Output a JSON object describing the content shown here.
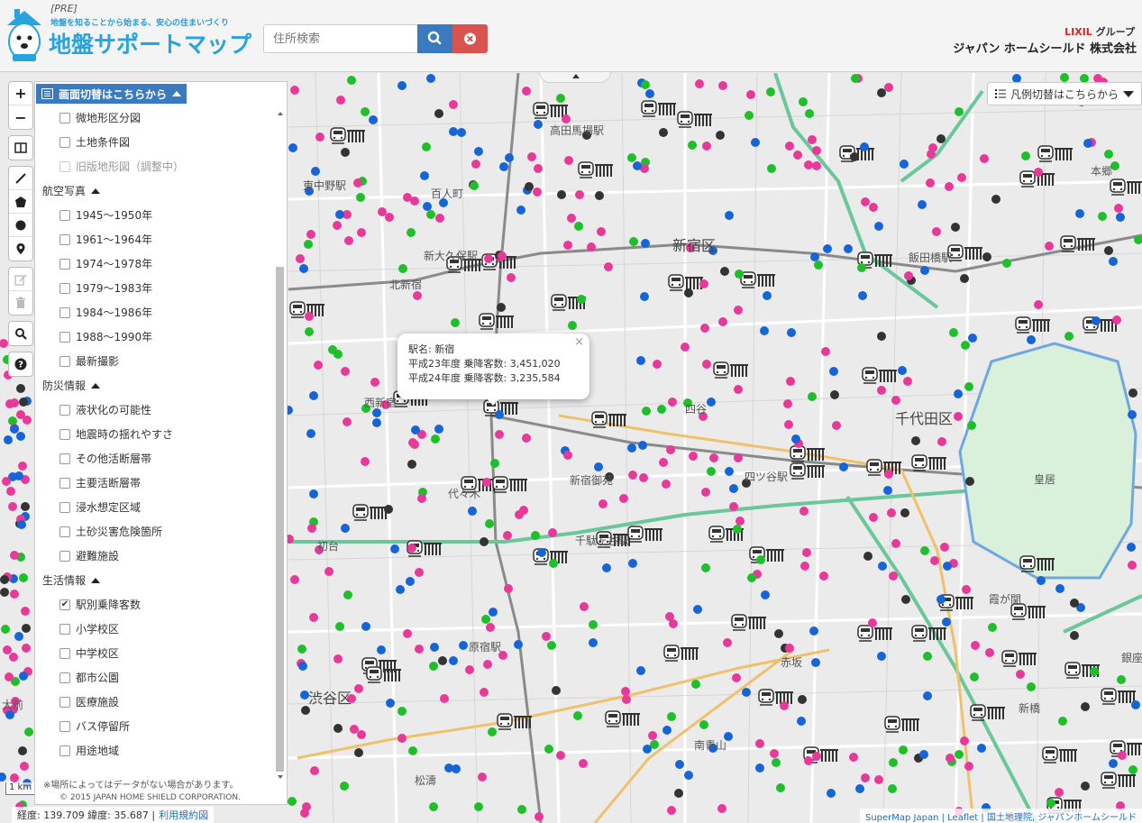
{
  "header": {
    "pre_tag": "[PRE]",
    "tagline": "地盤を知ることから始まる、安心の住まいづくり",
    "title": "地盤サポートマップ",
    "search_placeholder": "住所検索",
    "search_button_icon": "search-icon",
    "clear_button_icon": "close-circle-icon",
    "brand_lx": "LIXIL",
    "brand_group": "グループ",
    "company": "ジャパン ホームシールド 株式会社",
    "colors": {
      "title": "#29a3de",
      "search_btn": "#3a7bbf",
      "clear_btn": "#d9534f",
      "lixil": "#d9251c"
    }
  },
  "panel": {
    "toggle_label": "画面切替はこちらから",
    "items_top": [
      {
        "label": "微地形区分図",
        "checked": false,
        "disabled": false
      },
      {
        "label": "土地条件図",
        "checked": false,
        "disabled": false
      },
      {
        "label": "旧版地形図（調整中）",
        "checked": false,
        "disabled": true
      }
    ],
    "sections": [
      {
        "title": "航空写真",
        "items": [
          "1945～1950年",
          "1961～1964年",
          "1974～1978年",
          "1979～1983年",
          "1984～1986年",
          "1988～1990年",
          "最新撮影"
        ],
        "checked": [
          false,
          false,
          false,
          false,
          false,
          false,
          false
        ]
      },
      {
        "title": "防災情報",
        "items": [
          "液状化の可能性",
          "地震時の揺れやすさ",
          "その他活断層帯",
          "主要活断層帯",
          "浸水想定区域",
          "土砂災害危険箇所",
          "避難施設"
        ],
        "checked": [
          false,
          false,
          false,
          false,
          false,
          false,
          false
        ]
      },
      {
        "title": "生活情報",
        "items": [
          "駅別乗降客数",
          "小学校区",
          "中学校区",
          "都市公園",
          "医療施設",
          "バス停留所",
          "用途地域"
        ],
        "checked": [
          true,
          false,
          false,
          false,
          false,
          false,
          false
        ]
      }
    ],
    "note": "※場所によってはデータがない場合があります。",
    "copyright": "© 2015 JAPAN HOME SHIELD CORPORATION."
  },
  "legend": {
    "label": "凡例切替はこちらから"
  },
  "popup": {
    "line1": "駅名: 新宿",
    "line2": "平成23年度 乗降客数: 3,451,020",
    "line3": "平成24年度 乗降客数: 3,235,584",
    "close": "×"
  },
  "status": {
    "coords": "経度: 139.709 緯度: 35.687 |",
    "terms": "利用規約図",
    "attribution": "SuperMap Japan | Leaflet | 国土地理院, ジャパンホームシールド",
    "scale": "1 km"
  },
  "map_labels": {
    "takadanobaba": "高田馬場駅",
    "higashinakano": "東中野駅",
    "hyakunin": "百人町",
    "shinokubo": "新大久保駅",
    "shinjuku_ku": "新宿区",
    "iidabashi": "飯田橋駅",
    "kita_shinjuku": "北新宿",
    "nishi_shinjuku": "西新宿",
    "yotsuya": "四谷",
    "shinjuku_gyoen": "新宿御苑",
    "yotsuyasanchome": "四ツ谷駅",
    "chiyoda_ku": "千代田区",
    "kokyo": "皇居",
    "yoyogi": "代々木",
    "sendagaya": "千駄ヶ谷駅",
    "harajuku": "原宿駅",
    "kasumigaseki": "霞が関",
    "akasaka": "赤坂",
    "shibuya_ku": "渋谷区",
    "minami_aoyama": "南青山",
    "shinbashi": "新橋",
    "shoto": "松濤",
    "hatsudai": "初台",
    "ginza": "銀座",
    "hongo": "本郷",
    "omae": "大前"
  },
  "dot_colors": {
    "pink": "#e8399a",
    "green": "#1fbf2a",
    "blue": "#1565d8",
    "dark": "#333333"
  }
}
